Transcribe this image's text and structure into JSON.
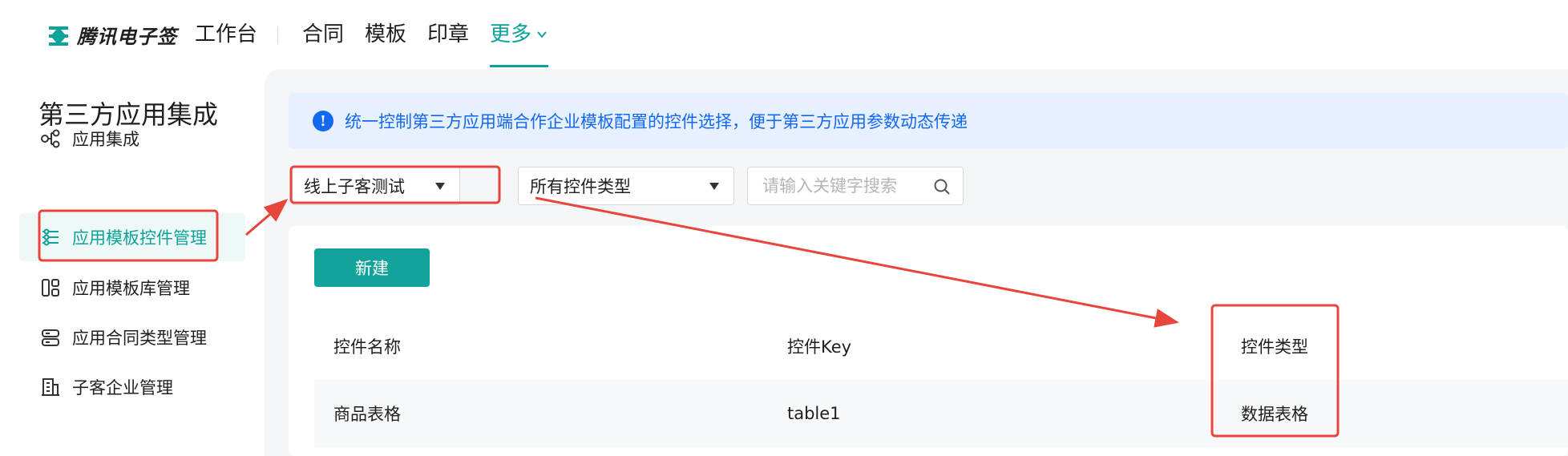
{
  "app": {
    "logo_text": "腾讯电子签"
  },
  "topnav": {
    "items": [
      {
        "label": "工作台"
      },
      {
        "label": "合同"
      },
      {
        "label": "模板"
      },
      {
        "label": "印章"
      },
      {
        "label": "更多"
      }
    ],
    "active": "更多"
  },
  "sidebar": {
    "title": "第三方应用集成",
    "items": [
      {
        "label": "应用集成",
        "icon": "share-nodes-icon"
      },
      {
        "label": "应用模板控件管理",
        "icon": "sliders-icon",
        "active": true
      },
      {
        "label": "应用模板库管理",
        "icon": "layout-icon"
      },
      {
        "label": "应用合同类型管理",
        "icon": "stack-icon"
      },
      {
        "label": "子客企业管理",
        "icon": "building-icon"
      }
    ]
  },
  "notice": {
    "text": "统一控制第三方应用端合作企业模板配置的控件选择，便于第三方应用参数动态传递"
  },
  "filters": {
    "app_select": "线上子客测试",
    "type_select": "所有控件类型",
    "search_placeholder": "请输入关键字搜索"
  },
  "actions": {
    "new_label": "新建"
  },
  "table": {
    "columns": [
      "控件名称",
      "控件Key",
      "控件类型"
    ],
    "rows": [
      [
        "商品表格",
        "table1",
        "数据表格"
      ]
    ]
  },
  "colors": {
    "brand": "#0da39a",
    "info": "#1368f0",
    "annotation": "#e8453c"
  }
}
